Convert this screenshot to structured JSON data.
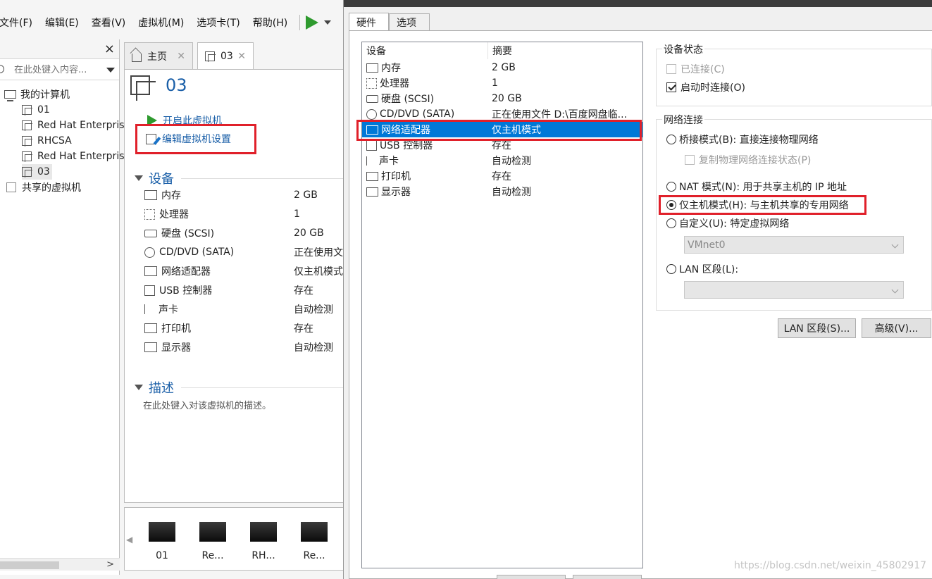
{
  "menubar": {
    "items": [
      "文件(F)",
      "编辑(E)",
      "查看(V)",
      "虚拟机(M)",
      "选项卡(T)",
      "帮助(H)"
    ]
  },
  "library": {
    "search_placeholder": "在此处键入内容...",
    "root": "我的计算机",
    "vms": [
      "01",
      "Red Hat Enterprise Linux",
      "RHCSA",
      "Red Hat Enterprise Linux",
      "03"
    ],
    "shared": "共享的虚拟机"
  },
  "tabs": [
    {
      "label": "主页"
    },
    {
      "label": "03"
    }
  ],
  "vm": {
    "title": "03",
    "actions": {
      "power_on": "开启此虚拟机",
      "edit_settings": "编辑虚拟机设置"
    },
    "devices_header": "设备",
    "devices": [
      {
        "name": "内存",
        "value": "2 GB",
        "icon": "memory-icon"
      },
      {
        "name": "处理器",
        "value": "1",
        "icon": "processor-icon"
      },
      {
        "name": "硬盘 (SCSI)",
        "value": "20 GB",
        "icon": "harddisk-icon"
      },
      {
        "name": "CD/DVD (SATA)",
        "value": "正在使用文件",
        "icon": "cdrom-icon"
      },
      {
        "name": "网络适配器",
        "value": "仅主机模式",
        "icon": "network-icon"
      },
      {
        "name": "USB 控制器",
        "value": "存在",
        "icon": "usb-icon"
      },
      {
        "name": "声卡",
        "value": "自动检测",
        "icon": "sound-icon"
      },
      {
        "name": "打印机",
        "value": "存在",
        "icon": "printer-icon"
      },
      {
        "name": "显示器",
        "value": "自动检测",
        "icon": "display-icon"
      }
    ],
    "desc_header": "描述",
    "desc_placeholder": "在此处键入对该虚拟机的描述。"
  },
  "thumbnails": [
    "01",
    "Re...",
    "RH...",
    "Re..."
  ],
  "dialog": {
    "tabs": [
      "硬件",
      "选项"
    ],
    "device_list": {
      "col_device": "设备",
      "col_summary": "摘要",
      "rows": [
        {
          "name": "内存",
          "value": "2 GB"
        },
        {
          "name": "处理器",
          "value": "1"
        },
        {
          "name": "硬盘 (SCSI)",
          "value": "20 GB"
        },
        {
          "name": "CD/DVD (SATA)",
          "value": "正在使用文件 D:\\百度网盘临..."
        },
        {
          "name": "网络适配器",
          "value": "仅主机模式"
        },
        {
          "name": "USB 控制器",
          "value": "存在"
        },
        {
          "name": "声卡",
          "value": "自动检测"
        },
        {
          "name": "打印机",
          "value": "存在"
        },
        {
          "name": "显示器",
          "value": "自动检测"
        }
      ]
    },
    "device_status": {
      "title": "设备状态",
      "connected": "已连接(C)",
      "connect_at_power_on": "启动时连接(O)"
    },
    "network": {
      "title": "网络连接",
      "bridged": "桥接模式(B): 直接连接物理网络",
      "replicate": "复制物理网络连接状态(P)",
      "nat": "NAT 模式(N): 用于共享主机的 IP 地址",
      "host_only": "仅主机模式(H): 与主机共享的专用网络",
      "custom": "自定义(U): 特定虚拟网络",
      "custom_value": "VMnet0",
      "lan": "LAN 区段(L):",
      "lan_value": ""
    },
    "buttons": {
      "lan_segments": "LAN 区段(S)...",
      "advanced": "高级(V)..."
    }
  },
  "watermark": "https://blog.csdn.net/weixin_45802917"
}
